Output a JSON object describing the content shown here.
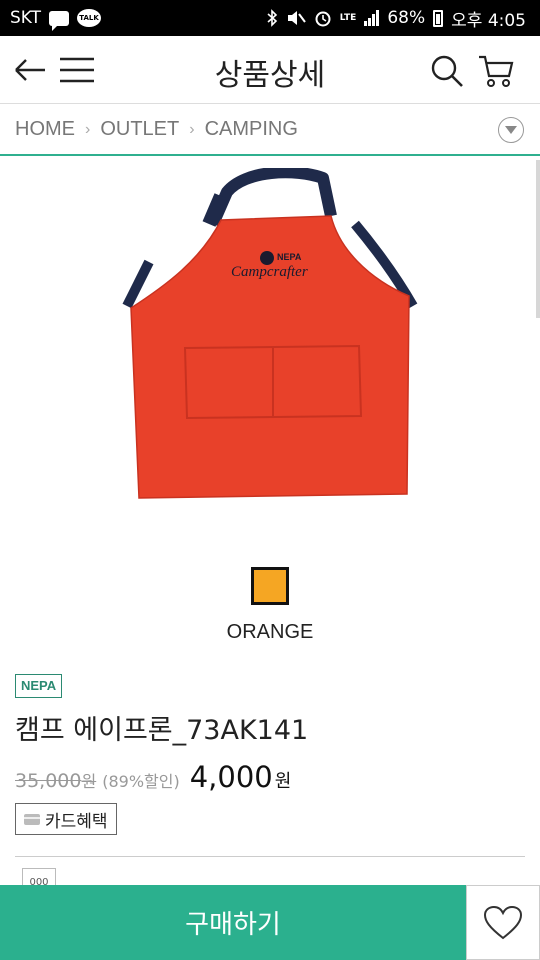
{
  "status_bar": {
    "carrier": "SKT",
    "talk_label": "TALK",
    "network": "LTE",
    "battery": "68%",
    "time": "오후 4:05"
  },
  "header": {
    "title": "상품상세"
  },
  "breadcrumb": {
    "items": [
      "HOME",
      "OUTLET",
      "CAMPING"
    ]
  },
  "product": {
    "image_brand_text": "NEPA",
    "image_logo_text": "Campcrafter",
    "color": {
      "name": "ORANGE",
      "swatch": "#f5a623"
    },
    "brand": "NEPA",
    "name": "캠프 에이프론_73AK141",
    "original_price": "35,000",
    "original_price_unit": "원",
    "discount": "(89%할인)",
    "sale_price": "4,000",
    "sale_price_unit": "원",
    "card_benefit": "카드혜택",
    "thumb_text": "000"
  },
  "footer": {
    "buy_label": "구매하기"
  },
  "colors": {
    "accent": "#2bb08e",
    "apron": "#e8412a",
    "strap": "#1f2a4a"
  }
}
